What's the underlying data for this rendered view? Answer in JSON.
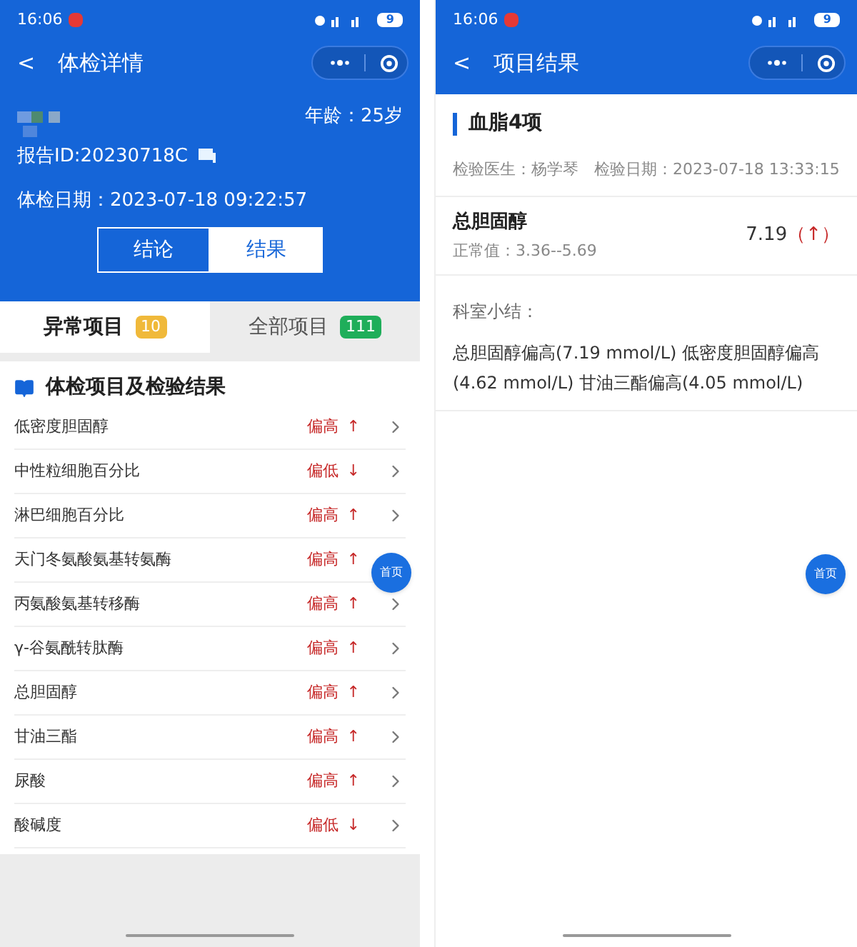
{
  "left": {
    "status_bar": {
      "time": "16:06",
      "battery": "9"
    },
    "nav": {
      "title": "体检详情",
      "back": "<"
    },
    "profile": {
      "age": "年龄：25岁",
      "report_id": "报告ID:20230718C",
      "exam_date": "体检日期：2023-07-18 09:22:57"
    },
    "view_tabs": [
      {
        "label": "结论",
        "selected": false
      },
      {
        "label": "结果",
        "selected": true
      }
    ],
    "filter_tabs": [
      {
        "label": "异常项目",
        "count": "10",
        "color": "#f0b93a",
        "selected": true
      },
      {
        "label": "全部项目",
        "count": "111",
        "color": "#1fae5a",
        "selected": false
      }
    ],
    "section_title": "体检项目及检验结果",
    "items": [
      {
        "name": "低密度胆固醇",
        "status": "偏高",
        "arrow": "↑"
      },
      {
        "name": "中性粒细胞百分比",
        "status": "偏低",
        "arrow": "↓"
      },
      {
        "name": "淋巴细胞百分比",
        "status": "偏高",
        "arrow": "↑"
      },
      {
        "name": "天门冬氨酸氨基转氨酶",
        "status": "偏高",
        "arrow": "↑"
      },
      {
        "name": "丙氨酸氨基转移酶",
        "status": "偏高",
        "arrow": "↑"
      },
      {
        "name": "γ-谷氨酰转肽酶",
        "status": "偏高",
        "arrow": "↑"
      },
      {
        "name": "总胆固醇",
        "status": "偏高",
        "arrow": "↑"
      },
      {
        "name": "甘油三酯",
        "status": "偏高",
        "arrow": "↑"
      },
      {
        "name": "尿酸",
        "status": "偏高",
        "arrow": "↑"
      },
      {
        "name": "酸碱度",
        "status": "偏低",
        "arrow": "↓"
      }
    ],
    "home_button": "首页"
  },
  "right": {
    "status_bar": {
      "time": "16:06",
      "battery": "9"
    },
    "nav": {
      "title": "项目结果",
      "back": "<"
    },
    "group_title": "血脂4项",
    "meta": "检验医生：杨学琴　检验日期：2023-07-18 13:33:15",
    "result": {
      "name": "总胆固醇",
      "normal": "正常值：3.36--5.69",
      "value": "7.19",
      "flag": "（↑）"
    },
    "summary_label": "科室小结：",
    "summary": "总胆固醇偏高(7.19 mmol/L) 低密度胆固醇偏高(4.62 mmol/L) 甘油三酯偏高(4.05 mmol/L)",
    "home_button": "首页"
  }
}
